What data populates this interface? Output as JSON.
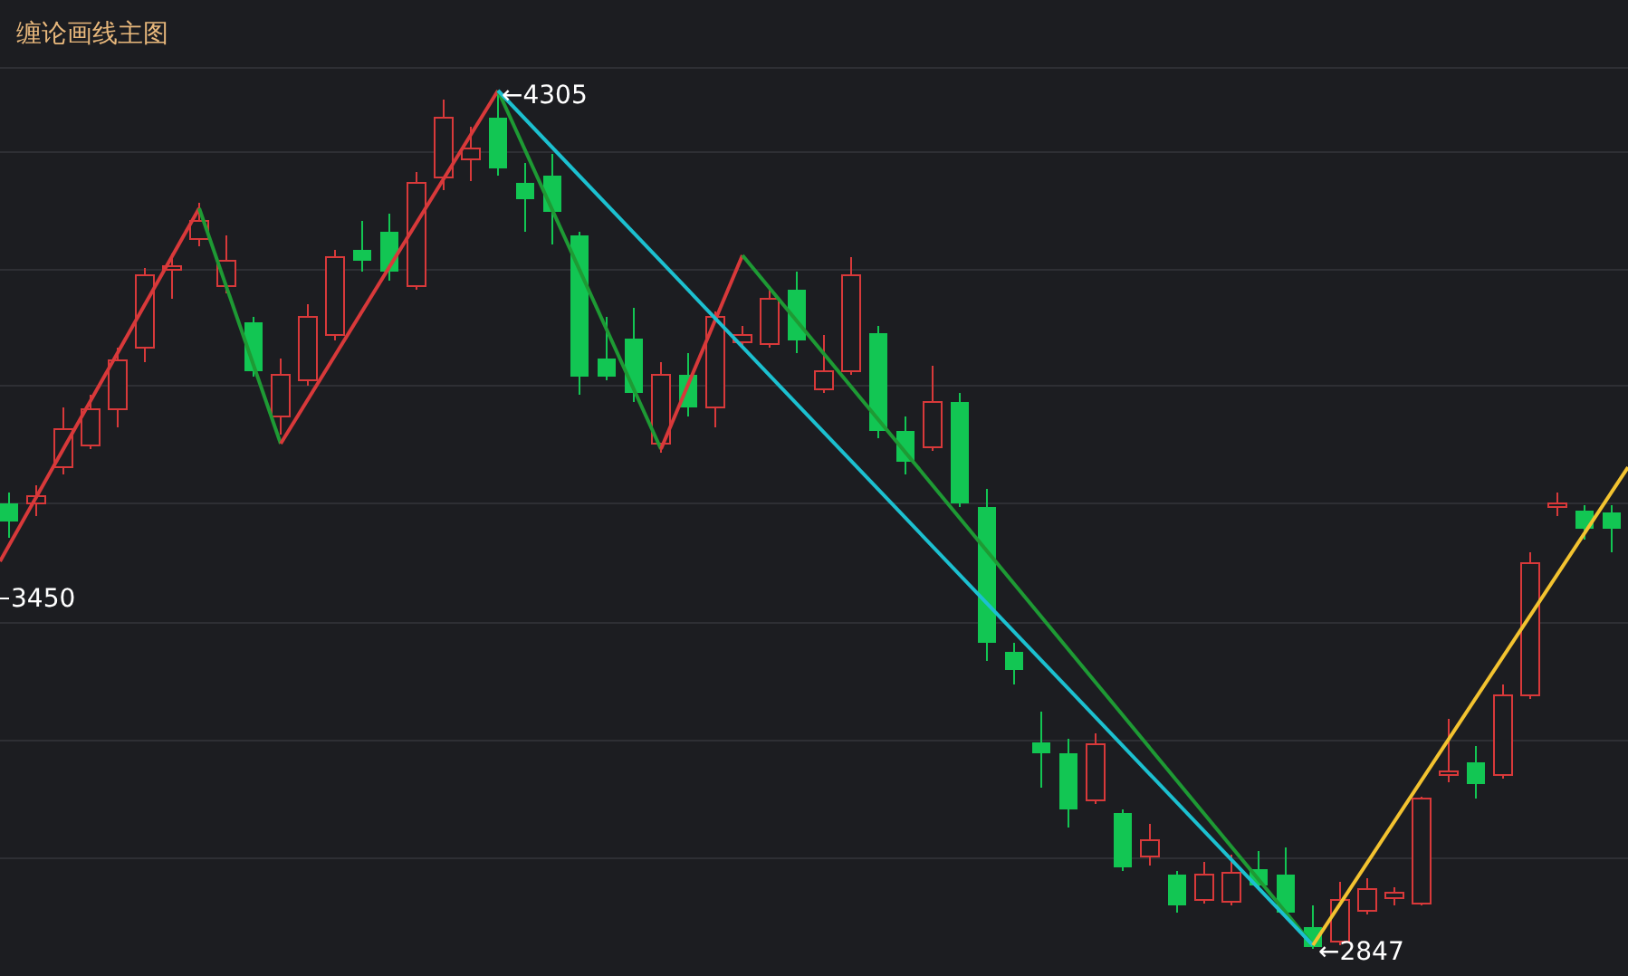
{
  "title": "缠论画线主图",
  "price_labels": [
    {
      "text": "←4305",
      "kind": "high"
    },
    {
      "text": "3450",
      "kind": "edge"
    },
    {
      "text": "←2847",
      "kind": "low"
    }
  ]
}
